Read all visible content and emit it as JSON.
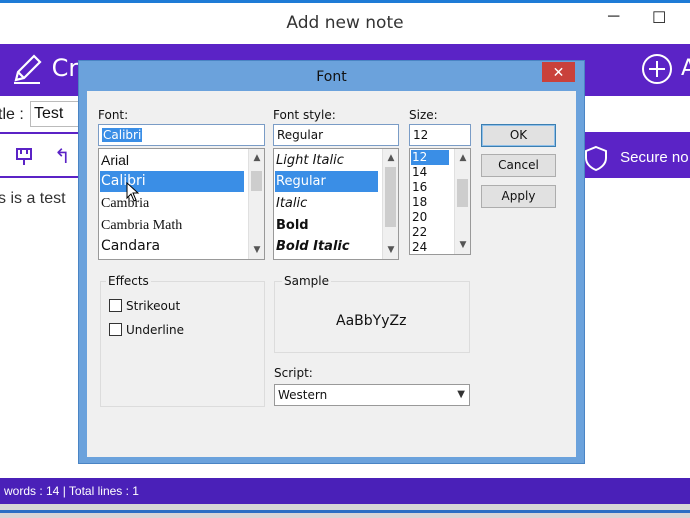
{
  "window": {
    "title": "Add new note",
    "minimize": "─",
    "maximize": "☐"
  },
  "toolbar": {
    "create_label": "Cr",
    "add_label": "A"
  },
  "title_row": {
    "label": "tle :",
    "value": "Test"
  },
  "format_bar": {
    "secure_label": "Secure no"
  },
  "editor": {
    "text": "s is a test"
  },
  "status": {
    "text": "words : 14   |   Total lines : 1"
  },
  "font_dialog": {
    "title": "Font",
    "close": "✕",
    "font_label": "Font:",
    "font_value": "Calibri",
    "font_list": [
      "Arial",
      "Calibri",
      "Cambria",
      "Cambria Math",
      "Candara"
    ],
    "font_selected": "Calibri",
    "style_label": "Font style:",
    "style_value": "Regular",
    "style_list": [
      "Light Italic",
      "Regular",
      "Italic",
      "Bold",
      "Bold Italic"
    ],
    "style_selected": "Regular",
    "size_label": "Size:",
    "size_value": "12",
    "size_list": [
      "12",
      "14",
      "16",
      "18",
      "20",
      "22",
      "24"
    ],
    "size_selected": "12",
    "ok": "OK",
    "cancel": "Cancel",
    "apply": "Apply",
    "effects_label": "Effects",
    "strikeout": "Strikeout",
    "underline": "Underline",
    "sample_label": "Sample",
    "sample_text": "AaBbYyZz",
    "script_label": "Script:",
    "script_value": "Western"
  },
  "icons": {
    "create": "pencil-icon",
    "add": "plus-circle-icon",
    "bookmark": "bookmark-icon",
    "undo": "undo-icon",
    "secure": "shield-icon"
  },
  "colors": {
    "accent": "#5b23c6",
    "status_bar": "#4a20b8",
    "dialog_frame": "#6ba2dc",
    "selection": "#3a8ee6",
    "close_button": "#c9413b"
  }
}
